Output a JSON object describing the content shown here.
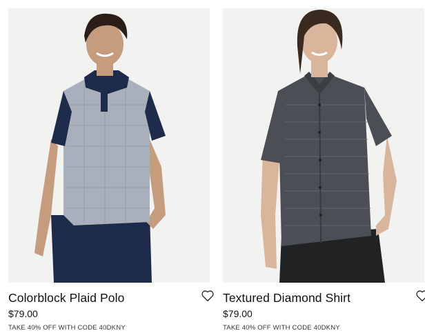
{
  "products": [
    {
      "title": "Colorblock Plaid Polo",
      "price": "$79.00",
      "promo": "TAKE 40% OFF WITH CODE 40DKNY",
      "image_icon": "product-photo-polo",
      "wishlist_icon": "heart-outline-icon"
    },
    {
      "title": "Textured Diamond Shirt",
      "price": "$79.00",
      "promo": "TAKE 40% OFF WITH CODE 40DKNY",
      "image_icon": "product-photo-shirt",
      "wishlist_icon": "heart-outline-icon"
    }
  ],
  "colors": {
    "image_background": "#f2f2f1",
    "polo_body": "#a9b0bb",
    "polo_navy": "#1f2b4a",
    "shirt_body": "#4b4f55",
    "pants_navy": "#1d2a4a",
    "pants_black": "#202224"
  }
}
